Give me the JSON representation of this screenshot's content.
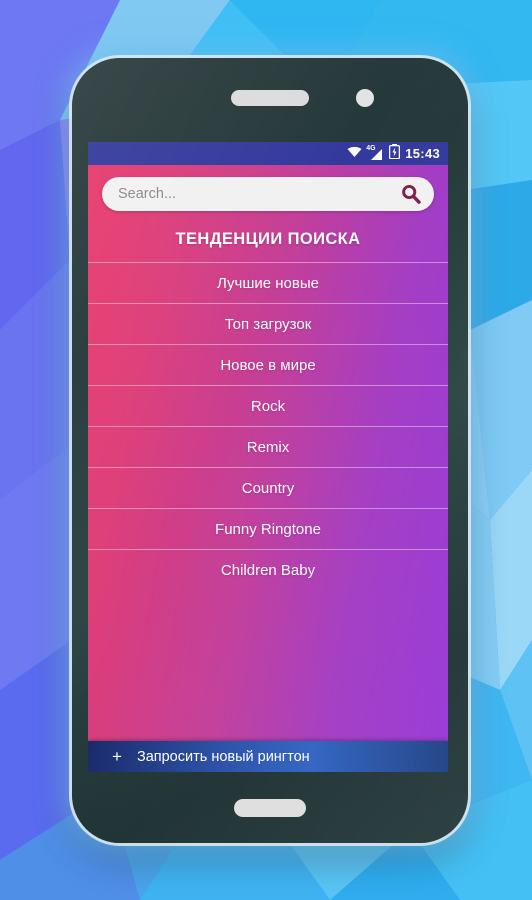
{
  "background": {
    "style": "low-poly-triangles",
    "colors": [
      "#35b3ef",
      "#4fc5f5",
      "#5f7bf0",
      "#6f6ef2",
      "#8f7af2",
      "#2aa0e0",
      "#7fd4f7",
      "#3f5ce8"
    ]
  },
  "device": {
    "frame_color": "#27393b",
    "speaker": "earpiece-speaker",
    "camera": "front-camera",
    "home_button": "home-button"
  },
  "status_bar": {
    "background": "#333a9c",
    "wifi_icon": "wifi-icon",
    "network_label": "4G",
    "signal_icon": "cell-signal-icon",
    "battery_icon": "battery-charging-icon",
    "time": "15:43"
  },
  "search": {
    "placeholder": "Search...",
    "value": "",
    "icon": "search-icon",
    "icon_color": "#7b2150",
    "background": "#f1f1f1"
  },
  "section": {
    "title": "ТЕНДЕНЦИИ ПОИСКА"
  },
  "list": {
    "items": [
      {
        "label": "Лучшие новые"
      },
      {
        "label": "Топ загрузок"
      },
      {
        "label": "Новое в мире"
      },
      {
        "label": "Rock"
      },
      {
        "label": "Remix"
      },
      {
        "label": "Country"
      },
      {
        "label": "Funny Ringtone"
      },
      {
        "label": "Children Baby"
      }
    ]
  },
  "request_bar": {
    "plus": "+",
    "label": "Запросить новый рингтон",
    "background": "#2a51a8"
  },
  "theme": {
    "gradient_start": "#e8396c",
    "gradient_end": "#9634d6",
    "accent_blue": "#2f63c2",
    "text_on_gradient": "#ffffff"
  }
}
